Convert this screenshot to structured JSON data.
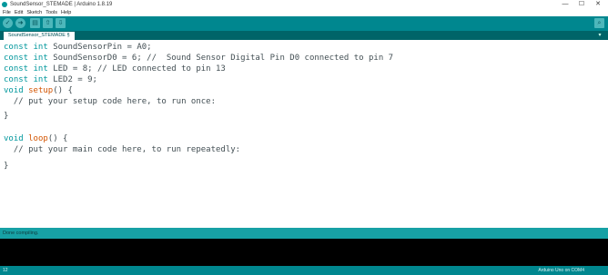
{
  "window": {
    "title": "SoundSensor_STEMADE | Arduino 1.8.19",
    "controls": {
      "minimize": "—",
      "maximize": "☐",
      "close": "✕"
    }
  },
  "menu": [
    "File",
    "Edit",
    "Sketch",
    "Tools",
    "Help"
  ],
  "toolbar": {
    "verify_icon": "check-icon",
    "upload_icon": "arrow-right-icon",
    "new_icon": "new-file-icon",
    "open_icon": "open-icon",
    "save_icon": "save-icon",
    "serial_icon": "magnifier-icon"
  },
  "tab": {
    "label": "SoundSensor_STEMADE §",
    "menu_glyph": "▾"
  },
  "code": {
    "lines": [
      [
        "",
        "const int SoundSensorPin = A0;"
      ],
      [
        "",
        "const int SoundSensorD0 = 6; //  Sound Sensor Digital Pin D0 connected to pin 7"
      ],
      [
        "",
        "const int LED = 8; // LED connected to pin 13"
      ],
      [
        "",
        "const int LED2 = 9;"
      ],
      [
        "",
        "void setup() {"
      ],
      [
        "",
        "  // put your setup code here, to run once:"
      ],
      [
        "",
        ""
      ],
      [
        "",
        "}"
      ],
      [
        "",
        ""
      ],
      [
        "",
        "void loop() {"
      ],
      [
        "",
        "  // put your main code here, to run repeatedly:"
      ],
      [
        "",
        ""
      ],
      [
        "",
        "}"
      ]
    ]
  },
  "status": {
    "text": "Done compiling."
  },
  "bottom": {
    "line_number": "12",
    "board": "Arduino Uno on COM4"
  },
  "colors": {
    "toolbar": "#00878f",
    "tabstrip": "#006468",
    "status": "#17a1a5",
    "console": "#000000"
  }
}
